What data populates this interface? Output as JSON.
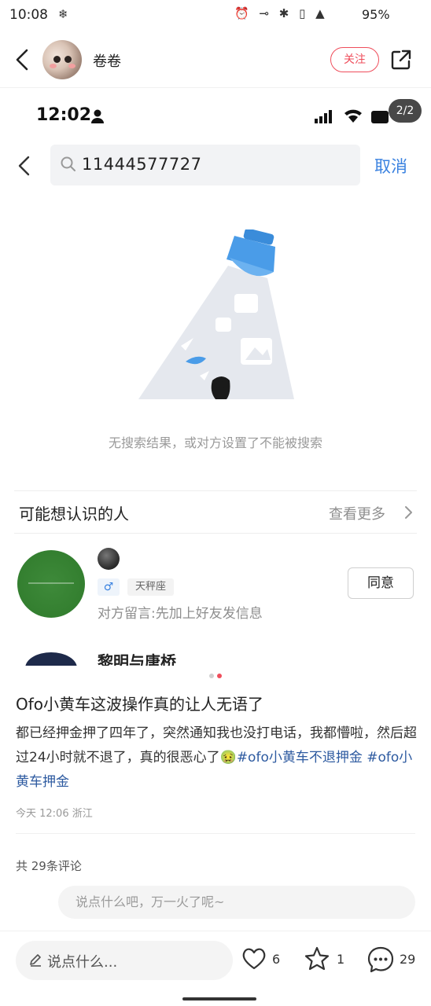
{
  "status_bar": {
    "time": "10:08",
    "snow_icon": "❄",
    "icons": "⏰ ⊸ ✱ ▯ ▲",
    "battery": "95%"
  },
  "header": {
    "username": "卷卷",
    "follow_label": "关注"
  },
  "screenshot": {
    "time": "12:02",
    "page_indicator": "2/2",
    "search_query": "11444577727",
    "cancel_label": "取消",
    "empty_text": "无搜索结果，或对方设置了不能被搜索",
    "section_title": "可能想认识的人",
    "see_more": "查看更多",
    "person": {
      "gender": "♂",
      "zodiac": "天秤座",
      "message": "对方留言:先加上好友发信息",
      "agree_label": "同意"
    },
    "next_person_name": "黎明与唐桥"
  },
  "post": {
    "title": "Ofo小黄车这波操作真的让人无语了",
    "body_text": "都已经押金押了四年了，突然通知我也没打电话，我都懵啦，然后超过24小时就不退了，真的很恶心了🤢",
    "tag1": "#ofo小黄车不退押金",
    "tag2": "#ofo小黄车押金",
    "meta": "今天 12:06 浙江",
    "comments_count": "共 29条评论",
    "comment_placeholder": "说点什么吧，万一火了呢~"
  },
  "bottom_bar": {
    "say_label": "说点什么...",
    "likes": "6",
    "stars": "1",
    "comments": "29"
  },
  "colors": {
    "accent_red": "#ef4d5b",
    "link_blue": "#3a82e0",
    "tag_blue": "#2d5aa0"
  }
}
